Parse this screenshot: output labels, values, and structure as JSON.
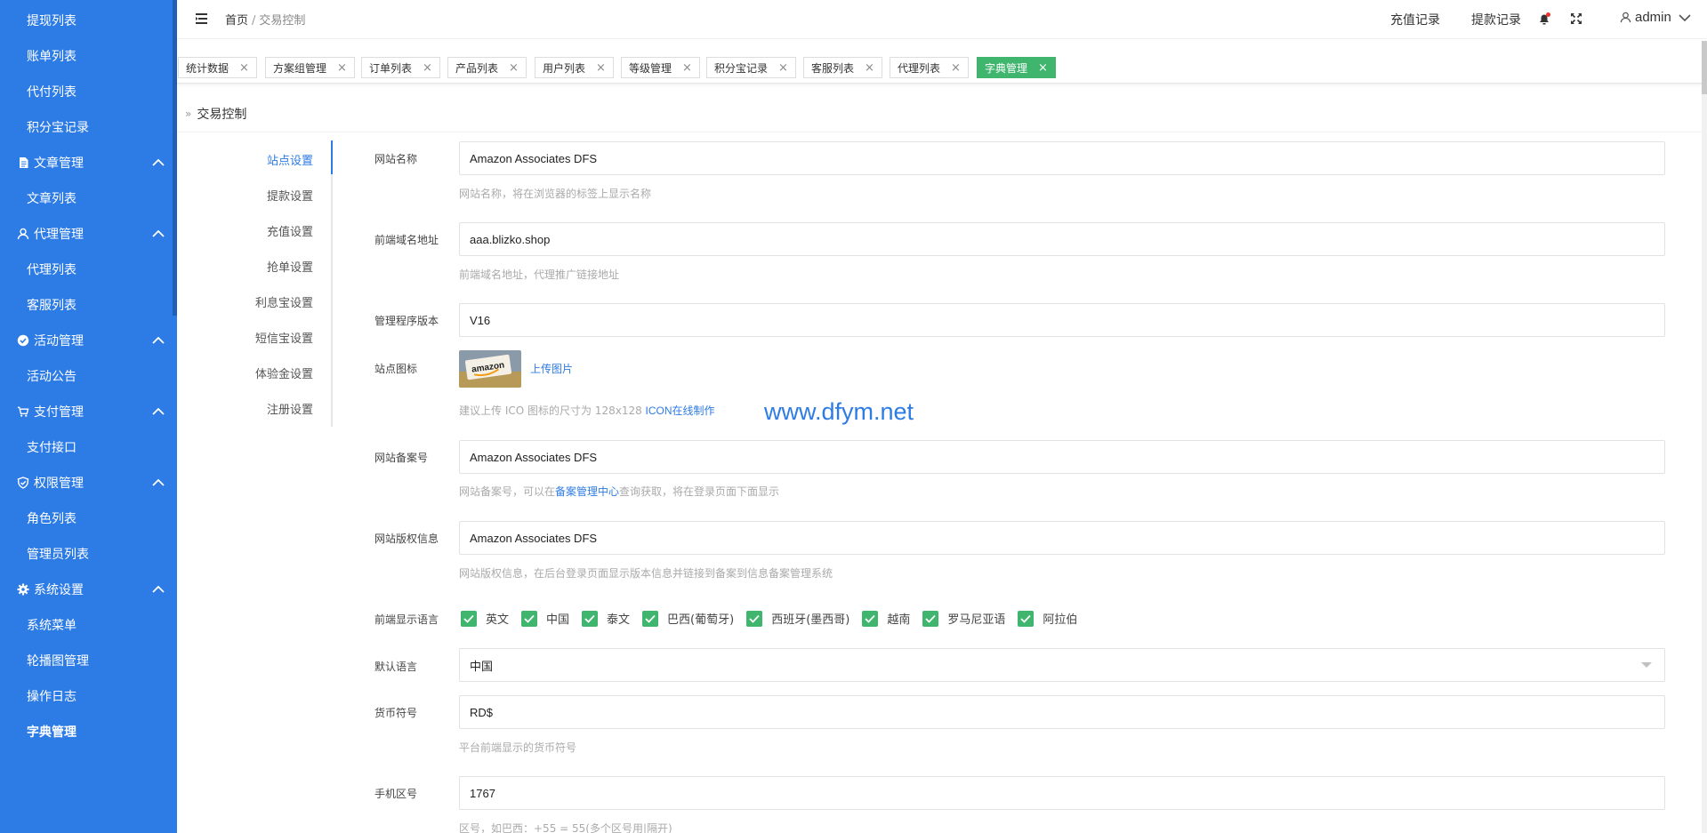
{
  "sidebar": {
    "items": [
      {
        "label": "提现列表",
        "type": "child"
      },
      {
        "label": "账单列表",
        "type": "child"
      },
      {
        "label": "代付列表",
        "type": "child"
      },
      {
        "label": "积分宝记录",
        "type": "child"
      },
      {
        "label": "文章管理",
        "type": "group",
        "icon": "document-icon"
      },
      {
        "label": "文章列表",
        "type": "child"
      },
      {
        "label": "代理管理",
        "type": "group",
        "icon": "user-icon"
      },
      {
        "label": "代理列表",
        "type": "child"
      },
      {
        "label": "客服列表",
        "type": "child"
      },
      {
        "label": "活动管理",
        "type": "group",
        "icon": "circle-check-icon"
      },
      {
        "label": "活动公告",
        "type": "child"
      },
      {
        "label": "支付管理",
        "type": "group",
        "icon": "cart-icon"
      },
      {
        "label": "支付接口",
        "type": "child"
      },
      {
        "label": "权限管理",
        "type": "group",
        "icon": "shield-icon"
      },
      {
        "label": "角色列表",
        "type": "child"
      },
      {
        "label": "管理员列表",
        "type": "child"
      },
      {
        "label": "系统设置",
        "type": "group",
        "icon": "gear-icon"
      },
      {
        "label": "系统菜单",
        "type": "child"
      },
      {
        "label": "轮播图管理",
        "type": "child"
      },
      {
        "label": "操作日志",
        "type": "child"
      },
      {
        "label": "字典管理",
        "type": "child",
        "active": true
      }
    ]
  },
  "header": {
    "breadcrumb_home": "首页",
    "breadcrumb_sep": "/",
    "breadcrumb_current": "交易控制",
    "recharge_link": "充值记录",
    "withdraw_link": "提款记录",
    "username": "admin"
  },
  "tabs": [
    {
      "label": "统计数据"
    },
    {
      "label": "方案组管理"
    },
    {
      "label": "订单列表"
    },
    {
      "label": "产品列表"
    },
    {
      "label": "用户列表"
    },
    {
      "label": "等级管理"
    },
    {
      "label": "积分宝记录"
    },
    {
      "label": "客服列表"
    },
    {
      "label": "代理列表"
    },
    {
      "label": "字典管理",
      "active": true
    }
  ],
  "tab_close_glyph": "×",
  "page": {
    "title_marker": "»",
    "title": "交易控制"
  },
  "settings_nav": [
    {
      "label": "站点设置",
      "active": true
    },
    {
      "label": "提款设置"
    },
    {
      "label": "充值设置"
    },
    {
      "label": "抢单设置"
    },
    {
      "label": "利息宝设置"
    },
    {
      "label": "短信宝设置"
    },
    {
      "label": "体验金设置"
    },
    {
      "label": "注册设置"
    }
  ],
  "form": {
    "site_name": {
      "label": "网站名称",
      "value": "Amazon Associates DFS",
      "hint": "网站名称，将在浏览器的标签上显示名称"
    },
    "frontend_domain": {
      "label": "前端域名地址",
      "value": "aaa.blizko.shop",
      "hint": "前端域名地址，代理推广链接地址"
    },
    "admin_version": {
      "label": "管理程序版本",
      "value": "V16"
    },
    "site_icon": {
      "label": "站点图标",
      "upload_label": "上传图片",
      "hint_prefix": "建议上传 ICO 图标的尺寸为 128x128",
      "hint_link": "ICON在线制作",
      "image_text": "amazon"
    },
    "site_record": {
      "label": "网站备案号",
      "value": "Amazon Associates DFS",
      "hint_prefix": "网站备案号，可以在",
      "hint_link": "备案管理中心",
      "hint_suffix": "查询获取，将在登录页面下面显示"
    },
    "site_copyright": {
      "label": "网站版权信息",
      "value": "Amazon Associates DFS",
      "hint": "网站版权信息，在后台登录页面显示版本信息并链接到备案到信息备案管理系统"
    },
    "languages": {
      "label": "前端显示语言",
      "options": [
        "英文",
        "中国",
        "泰文",
        "巴西(葡萄牙)",
        "西班牙(墨西哥)",
        "越南",
        "罗马尼亚语",
        "阿拉伯"
      ]
    },
    "default_language": {
      "label": "默认语言",
      "value": "中国"
    },
    "currency": {
      "label": "货币符号",
      "value": "RD$",
      "hint": "平台前端显示的货币符号"
    },
    "phone_code": {
      "label": "手机区号",
      "value": "1767",
      "hint": "区号，如巴西：+55 = 55(多个区号用|隔开)"
    }
  },
  "watermark": "www.dfym.net",
  "colors": {
    "primary": "#2d7be5",
    "success": "#3fb56e"
  }
}
